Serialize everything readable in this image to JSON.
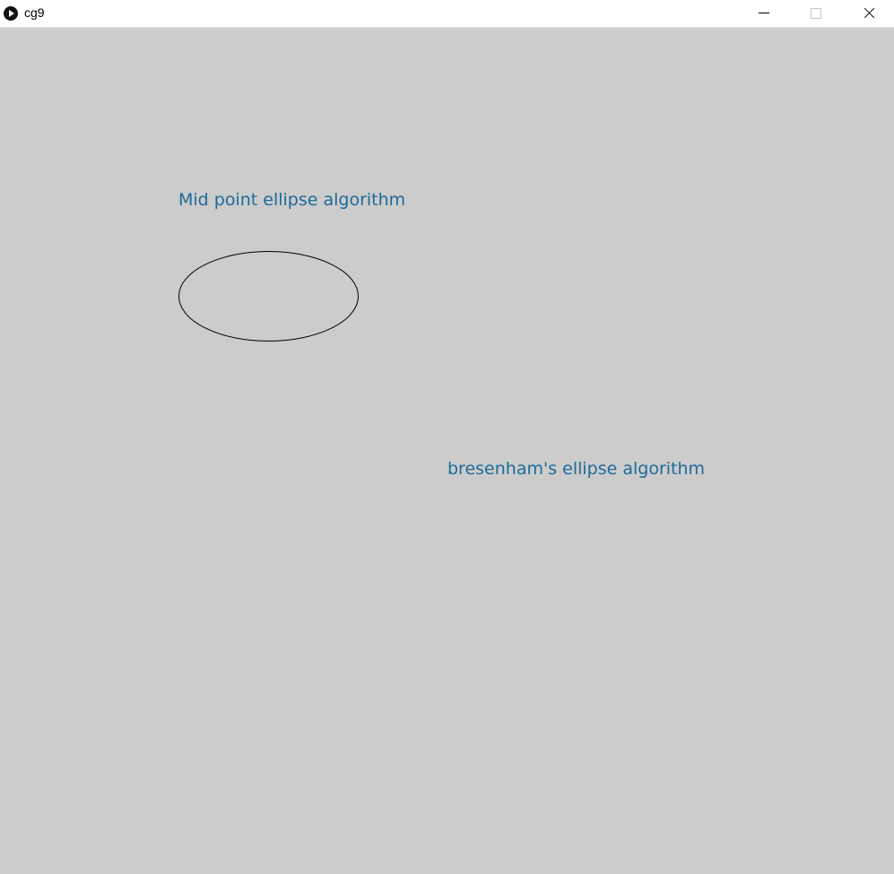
{
  "window": {
    "title": "cg9",
    "icons": {
      "app": "processing-play-icon",
      "minimize": "minimize-icon",
      "maximize": "maximize-icon",
      "close": "close-icon"
    }
  },
  "canvas": {
    "background": "#cccccc",
    "labels": {
      "midpoint": "Mid point ellipse algorithm",
      "bresenham": "bresenham's ellipse algorithm"
    },
    "label_color": "#1e6a9a",
    "ellipse_stroke": "#000000"
  }
}
